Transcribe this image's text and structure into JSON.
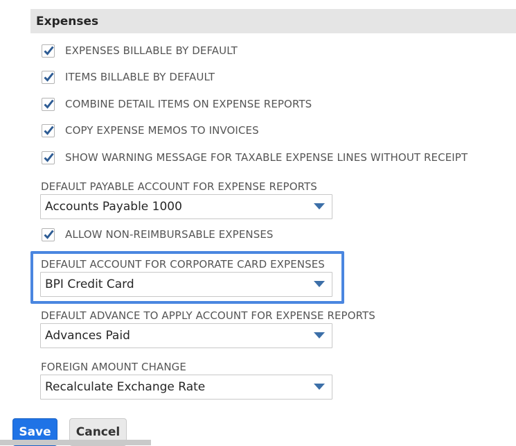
{
  "section": {
    "title": "Expenses"
  },
  "checkboxes": [
    {
      "label": "EXPENSES BILLABLE BY DEFAULT",
      "checked": true
    },
    {
      "label": "ITEMS BILLABLE BY DEFAULT",
      "checked": true
    },
    {
      "label": "COMBINE DETAIL ITEMS ON EXPENSE REPORTS",
      "checked": true
    },
    {
      "label": "COPY EXPENSE MEMOS TO INVOICES",
      "checked": true
    },
    {
      "label": "SHOW WARNING MESSAGE FOR TAXABLE EXPENSE LINES WITHOUT RECEIPT",
      "checked": true
    }
  ],
  "payable_account": {
    "label": "DEFAULT PAYABLE ACCOUNT FOR EXPENSE REPORTS",
    "value": "Accounts Payable 1000"
  },
  "non_reimbursable": {
    "label": "ALLOW NON-REIMBURSABLE EXPENSES",
    "checked": true
  },
  "corporate_card_account": {
    "label": "DEFAULT ACCOUNT FOR CORPORATE CARD EXPENSES",
    "value": "BPI Credit Card"
  },
  "advance_account": {
    "label": "DEFAULT ADVANCE TO APPLY ACCOUNT FOR EXPENSE REPORTS",
    "value": "Advances Paid"
  },
  "foreign_amount": {
    "label": "FOREIGN AMOUNT CHANGE",
    "value": "Recalculate Exchange Rate"
  },
  "buttons": {
    "save": "Save",
    "cancel": "Cancel"
  },
  "colors": {
    "checkmark": "#2e5c94",
    "dropdown_arrow": "#3c6fa8",
    "highlight": "#4a86e0",
    "save_button": "#1f73e6"
  },
  "icons": {
    "checkbox": "checkmark-icon",
    "dropdown": "chevron-down-icon"
  }
}
